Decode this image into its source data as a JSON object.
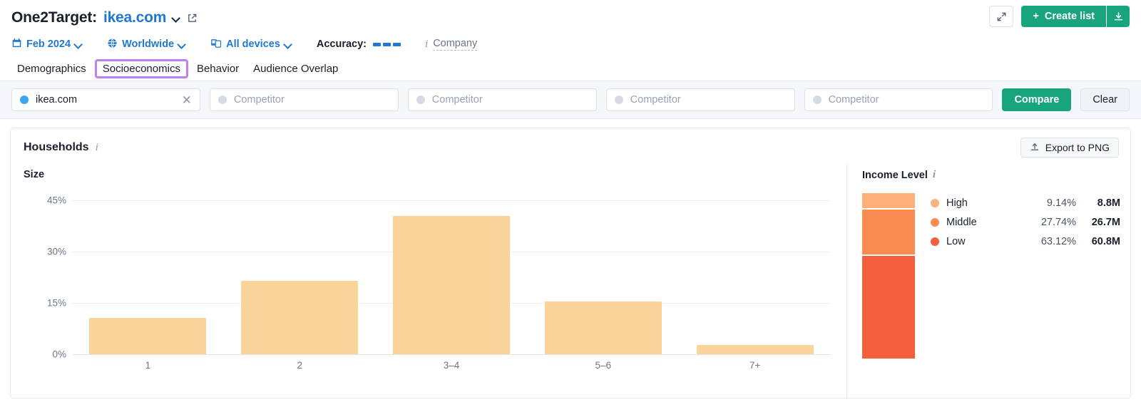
{
  "header": {
    "title_prefix": "One2Target:",
    "domain": "ikea.com",
    "external_link_icon": "external-link-icon",
    "filters": [
      {
        "icon": "calendar-icon",
        "label": "Feb 2024"
      },
      {
        "icon": "globe-icon",
        "label": "Worldwide"
      },
      {
        "icon": "devices-icon",
        "label": "All devices"
      }
    ],
    "accuracy_label": "Accuracy:",
    "accuracy_level": 3,
    "company_label": "Company",
    "expand_icon": "expand-icon",
    "create_list_label": "Create list",
    "create_list_plus": "+",
    "download_icon": "download-icon"
  },
  "tabs": [
    {
      "label": "Demographics",
      "highlighted": false
    },
    {
      "label": "Socioeconomics",
      "highlighted": true
    },
    {
      "label": "Behavior",
      "highlighted": false
    },
    {
      "label": "Audience Overlap",
      "highlighted": false
    }
  ],
  "compare": {
    "inputs": [
      {
        "value": "ikea.com",
        "placeholder": "",
        "dot": "blue",
        "has_clear": true,
        "clear_glyph": "✕"
      },
      {
        "value": "",
        "placeholder": "Competitor",
        "dot": "gray",
        "has_clear": false
      },
      {
        "value": "",
        "placeholder": "Competitor",
        "dot": "gray",
        "has_clear": false
      },
      {
        "value": "",
        "placeholder": "Competitor",
        "dot": "gray",
        "has_clear": false
      },
      {
        "value": "",
        "placeholder": "Competitor",
        "dot": "gray",
        "has_clear": false
      }
    ],
    "compare_label": "Compare",
    "clear_label": "Clear"
  },
  "card": {
    "title": "Households",
    "info_icon": "info-icon",
    "export_label": "Export to PNG",
    "export_icon": "upload-icon"
  },
  "chart_data": [
    {
      "type": "bar",
      "title": "Size",
      "categories": [
        "1",
        "2",
        "3–4",
        "5–6",
        "7+"
      ],
      "values": [
        10.6,
        21.4,
        40.4,
        15.4,
        2.8
      ],
      "xlabel": "",
      "ylabel": "",
      "ylim": [
        0,
        48
      ],
      "yticks": [
        0,
        15,
        30,
        45
      ],
      "ytick_labels": [
        "0%",
        "15%",
        "30%",
        "45%"
      ],
      "grid": true,
      "bar_color": "#fbd49b",
      "legend": "none"
    },
    {
      "type": "pie",
      "title": "Income Level",
      "subtype": "stacked-bar",
      "categories": [
        "High",
        "Middle",
        "Low"
      ],
      "values": [
        9.14,
        27.74,
        63.12
      ],
      "value_labels": [
        "9.14%",
        "27.74%",
        "63.12%"
      ],
      "absolute_labels": [
        "8.8M",
        "26.7M",
        "60.8M"
      ],
      "colors": [
        "#fcb07a",
        "#fb8c51",
        "#f5603c"
      ],
      "legend": "right"
    }
  ]
}
